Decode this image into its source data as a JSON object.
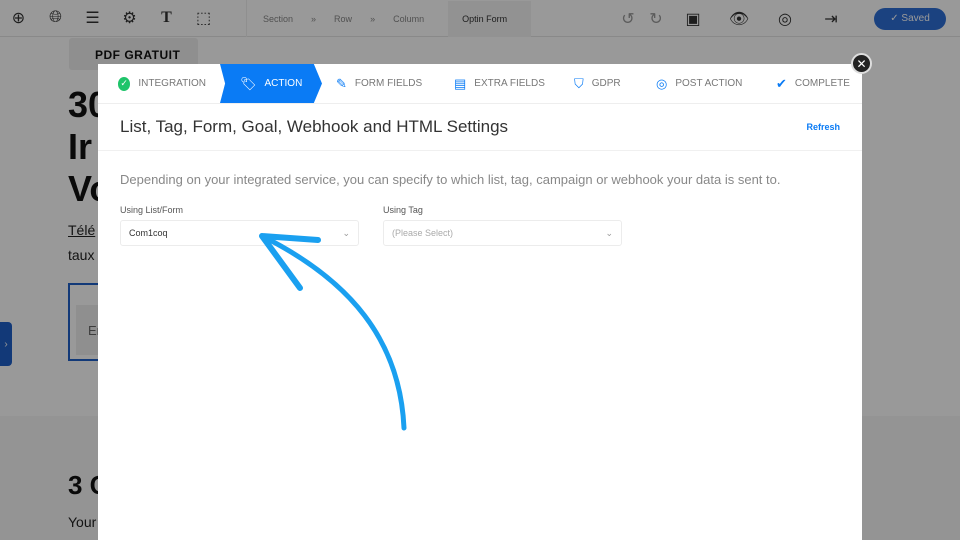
{
  "toolbar": {
    "icons": [
      "plus-circle-icon",
      "globe-icon",
      "layout-icon",
      "gear-icon",
      "text-icon",
      "select-icon"
    ],
    "breadcrumbs": [
      "Section",
      "»",
      "Row",
      "»",
      "Column"
    ],
    "active_crumb": "Optin Form",
    "saved_label": "Saved"
  },
  "background": {
    "badge": "PDF GRATUIT",
    "heading_lines": [
      "30",
      "Ir",
      "Vo"
    ],
    "para_lines": [
      "Télé",
      "taux"
    ],
    "email_placeholder": "En",
    "section_heading": "3 C",
    "section_text": "Your"
  },
  "modal": {
    "steps": [
      {
        "label": "INTEGRATION",
        "icon": "check-circle-icon"
      },
      {
        "label": "ACTION",
        "icon": "tag-icon",
        "active": true
      },
      {
        "label": "FORM FIELDS",
        "icon": "edit-icon"
      },
      {
        "label": "EXTRA FIELDS",
        "icon": "list-icon"
      },
      {
        "label": "GDPR",
        "icon": "shield-icon"
      },
      {
        "label": "POST ACTION",
        "icon": "cursor-click-icon"
      },
      {
        "label": "COMPLETE",
        "icon": "double-check-icon"
      }
    ],
    "title": "List, Tag, Form, Goal, Webhook and HTML Settings",
    "refresh": "Refresh",
    "description": "Depending on your integrated service, you can specify to which list, tag, campaign or webhook your data is sent to.",
    "list_label": "Using List/Form",
    "list_value": "Com1coq",
    "tag_label": "Using Tag",
    "tag_placeholder": "(Please Select)"
  },
  "colors": {
    "accent": "#0a7bf5",
    "arrow": "#1aa0f0",
    "success": "#1fc46a"
  }
}
